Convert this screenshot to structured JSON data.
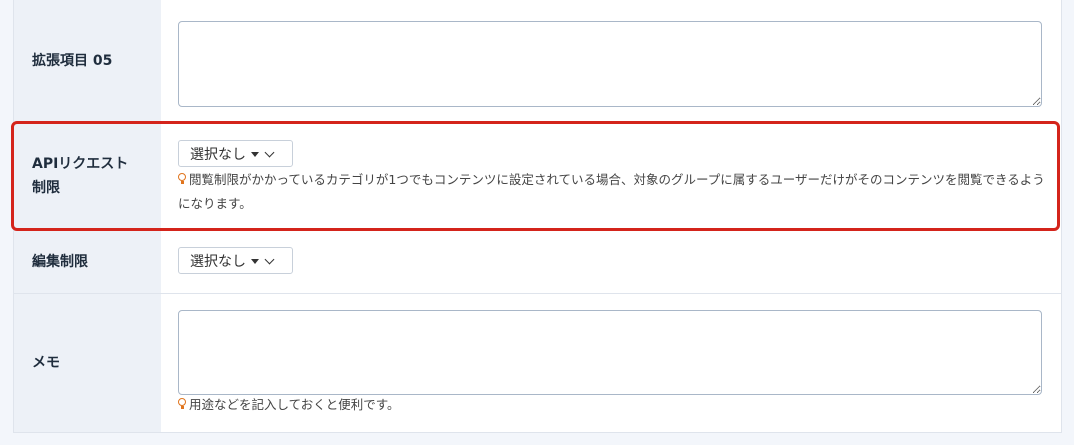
{
  "fields": [
    {
      "label": "拡張項目 05"
    },
    {
      "label_line1": "APIリクエスト",
      "label_line2": "制限",
      "select_value": "選択なし",
      "hint": "閲覧制限がかかっているカテゴリが1つでもコンテンツに設定されている場合、対象のグループに属するユーザーだけがそのコンテンツを閲覧できるようになります。"
    },
    {
      "label": "編集制限",
      "select_value": "選択なし"
    },
    {
      "label": "メモ",
      "hint": "用途などを記入しておくと便利です。"
    }
  ],
  "colors": {
    "highlight": "#d4241b",
    "hint_icon": "#e0741d",
    "label_bg": "#edf1f7"
  },
  "icons": [
    "caret-down-icon",
    "chevron-down-icon",
    "lightbulb-icon"
  ]
}
